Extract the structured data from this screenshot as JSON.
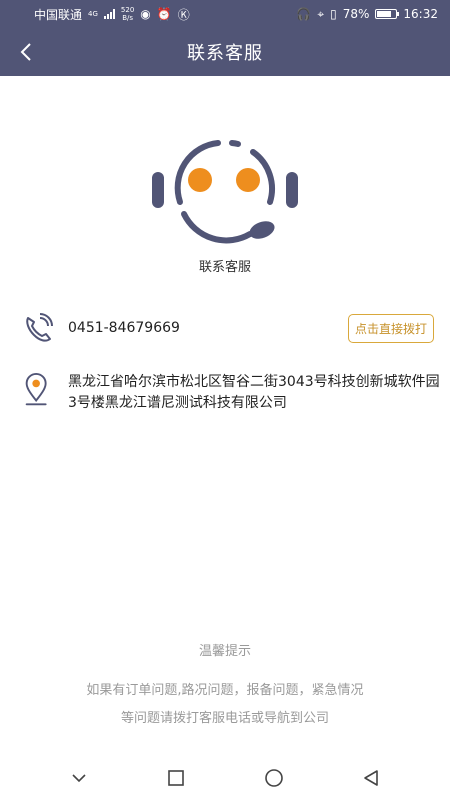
{
  "status_bar": {
    "carrier": "中国联通",
    "net_type": "4G",
    "net_speed_value": "520",
    "net_speed_unit": "B/s",
    "battery": "78%",
    "time": "16:32"
  },
  "header": {
    "title": "联系客服",
    "back_icon": "chevron-left-icon"
  },
  "service": {
    "icon": "customer-service-headset-icon",
    "label": "联系客服",
    "accent_color": "#515576",
    "eye_color": "#ee8e1e"
  },
  "contact": {
    "phone_icon": "phone-icon",
    "phone": "0451-84679669",
    "call_button": "点击直接拨打",
    "address_icon": "location-pin-icon",
    "address": "黑龙江省哈尔滨市松北区智谷二街3043号科技创新城软件园3号楼黑龙江谱尼测试科技有限公司"
  },
  "tips": {
    "title": "温馨提示",
    "line1": "如果有订单问题,路况问题，报备问题，紧急情况",
    "line2": "等问题请拨打客服电话或导航到公司"
  },
  "system_nav": {
    "icons": [
      "chevron-down-icon",
      "square-icon",
      "circle-icon",
      "triangle-back-icon"
    ]
  }
}
